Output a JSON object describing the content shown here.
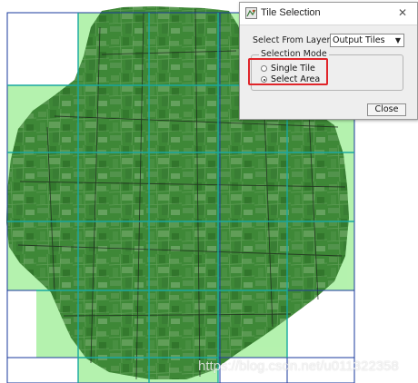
{
  "dialog": {
    "title": "Tile Selection",
    "close_icon": "close-icon",
    "app_icon": "app-icon",
    "select_from_layer_label": "Select From Layer",
    "layer_select_value": "Output Tiles",
    "selection_mode": {
      "title": "Selection Mode",
      "options": [
        {
          "label": "Single Tile",
          "checked": false
        },
        {
          "label": "Select Area",
          "checked": true
        }
      ]
    },
    "close_button_label": "Close"
  },
  "colors": {
    "tile_overlay": "#4fdc4f",
    "grid_line_blue": "#1a3a9c",
    "grid_line_teal": "#18a8a0",
    "highlight": "#e0252a"
  },
  "watermark": "https://blog.csdn.net/u011322358"
}
